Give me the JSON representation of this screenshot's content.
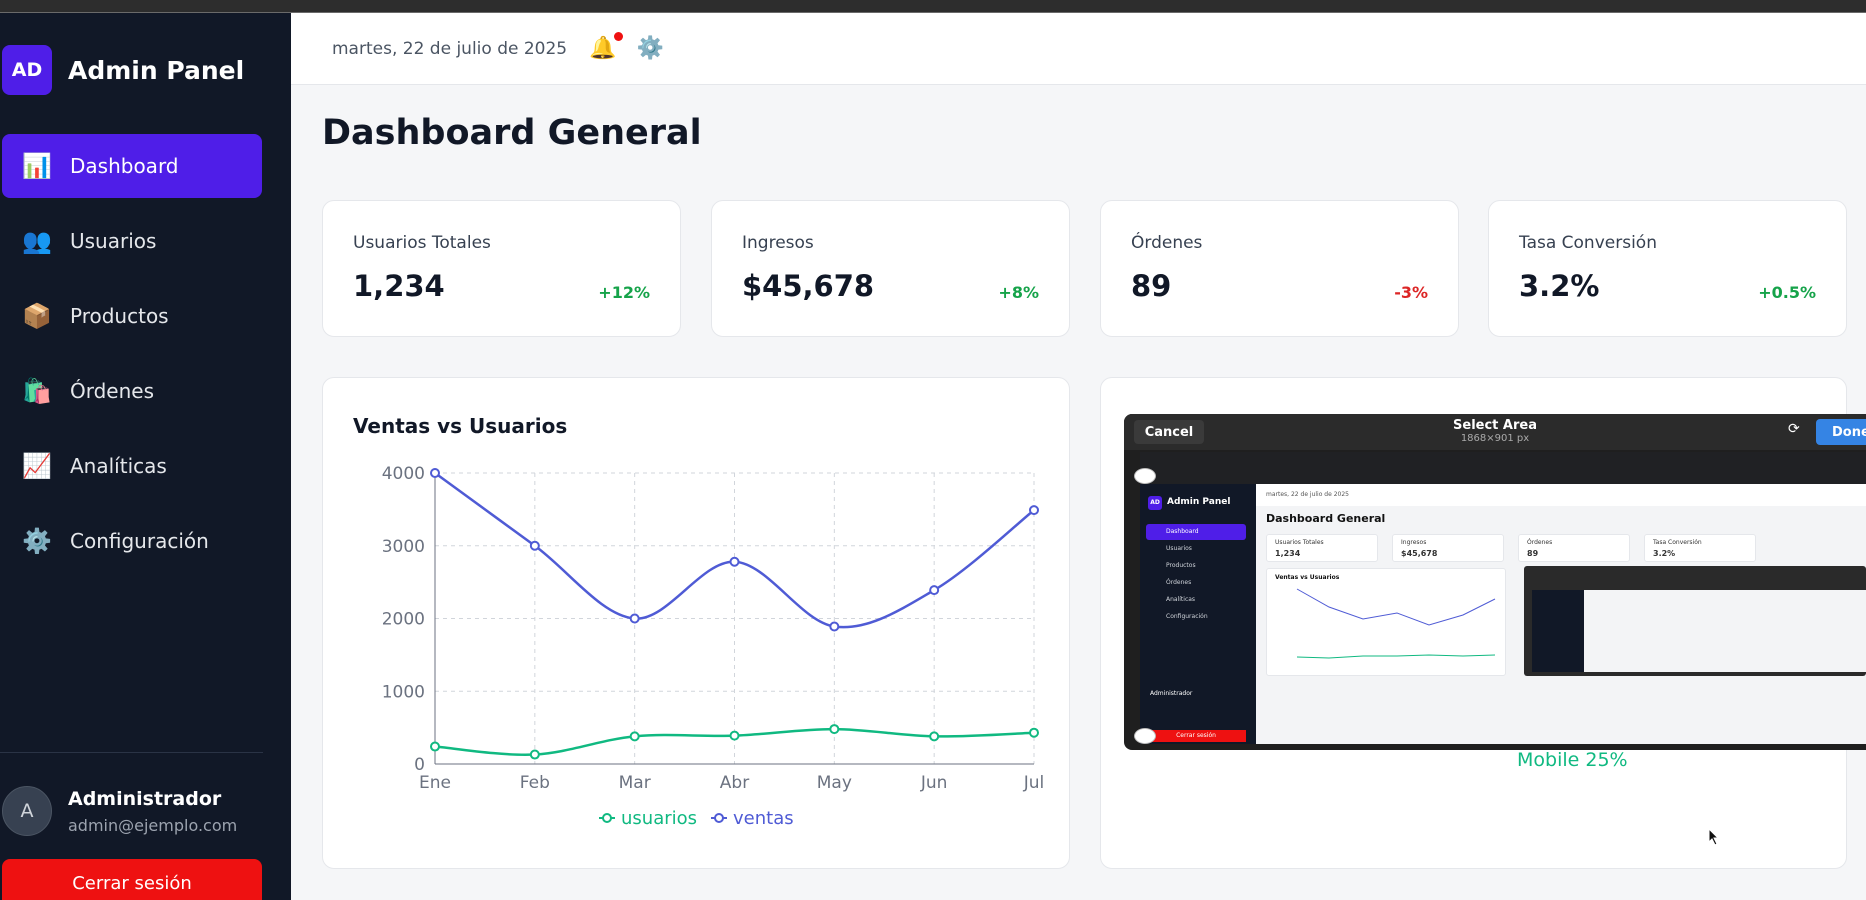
{
  "sidebar": {
    "brand_badge": "AD",
    "brand_title": "Admin Panel",
    "items": [
      {
        "icon": "bar-chart-icon",
        "glyph": "📊",
        "label": "Dashboard"
      },
      {
        "icon": "users-icon",
        "glyph": "👥",
        "label": "Usuarios"
      },
      {
        "icon": "package-icon",
        "glyph": "📦",
        "label": "Productos"
      },
      {
        "icon": "shopping-bags-icon",
        "glyph": "🛍️",
        "label": "Órdenes"
      },
      {
        "icon": "trend-up-icon",
        "glyph": "📈",
        "label": "Analíticas"
      },
      {
        "icon": "gear-icon",
        "glyph": "⚙️",
        "label": "Configuración"
      }
    ],
    "active_index": 0,
    "user": {
      "avatar": "A",
      "name": "Administrador",
      "email": "admin@ejemplo.com"
    },
    "logout_label": "Cerrar sesión"
  },
  "header": {
    "date": "martes, 22 de julio de 2025",
    "bell_glyph": "🔔",
    "gear_glyph": "⚙️"
  },
  "main": {
    "title": "Dashboard General",
    "stats": [
      {
        "label": "Usuarios Totales",
        "value": "1,234",
        "change": "+12%",
        "trend": "up"
      },
      {
        "label": "Ingresos",
        "value": "$45,678",
        "change": "+8%",
        "trend": "up"
      },
      {
        "label": "Órdenes",
        "value": "89",
        "change": "-3%",
        "trend": "down"
      },
      {
        "label": "Tasa Conversión",
        "value": "3.2%",
        "change": "+0.5%",
        "trend": "up"
      }
    ],
    "pie_label": "Mobile 25%"
  },
  "chart_data": {
    "type": "line",
    "title": "Ventas vs Usuarios",
    "categories": [
      "Ene",
      "Feb",
      "Mar",
      "Abr",
      "May",
      "Jun",
      "Jul"
    ],
    "series": [
      {
        "name": "usuarios",
        "color": "#10b981",
        "values": [
          240,
          130,
          380,
          390,
          480,
          380,
          430
        ]
      },
      {
        "name": "ventas",
        "color": "#4f5bd5",
        "values": [
          4000,
          3000,
          2000,
          2780,
          1890,
          2390,
          3490
        ]
      }
    ],
    "yticks": [
      0,
      1000,
      2000,
      3000,
      4000
    ],
    "ylim": [
      0,
      4000
    ],
    "grid": true,
    "legend": "bottom"
  },
  "overlay": {
    "cancel_label": "Cancel",
    "title": "Select Area",
    "subtitle": "1868×901 px",
    "done_label": "Done",
    "preview": {
      "brand": "Admin Panel",
      "nav": [
        "Dashboard",
        "Usuarios",
        "Productos",
        "Órdenes",
        "Analíticas",
        "Configuración"
      ],
      "date": "martes, 22 de julio de 2025",
      "title": "Dashboard General",
      "stats": [
        {
          "label": "Usuarios Totales",
          "value": "1,234"
        },
        {
          "label": "Ingresos",
          "value": "$45,678"
        },
        {
          "label": "Órdenes",
          "value": "89"
        },
        {
          "label": "Tasa Conversión",
          "value": "3.2%"
        }
      ],
      "chart_title": "Ventas vs Usuarios",
      "user": "Administrador",
      "logout": "Cerrar sesión"
    }
  }
}
